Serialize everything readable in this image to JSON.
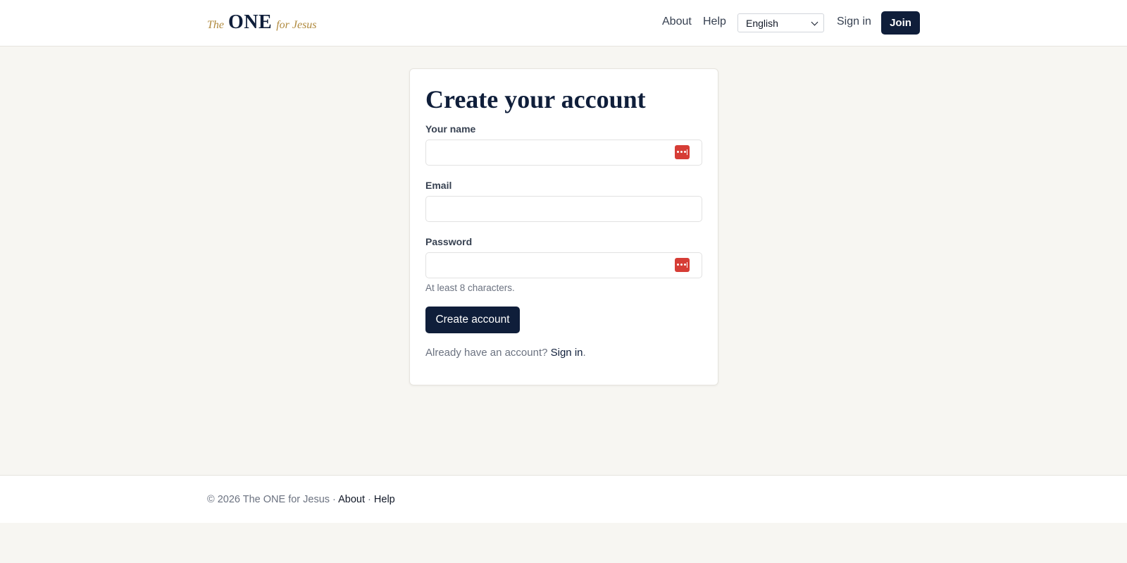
{
  "header": {
    "logo": {
      "the": "The",
      "one": "ONE",
      "rest": "for Jesus"
    },
    "nav": {
      "about": "About",
      "help": "Help",
      "sign_in": "Sign in",
      "join": "Join"
    },
    "language": {
      "selected": "English"
    }
  },
  "form": {
    "title": "Create your account",
    "name": {
      "label": "Your name",
      "value": ""
    },
    "email": {
      "label": "Email",
      "value": ""
    },
    "password": {
      "label": "Password",
      "value": "",
      "hint": "At least 8 characters."
    },
    "submit_label": "Create account",
    "signin_prompt": "Already have an account?",
    "signin_link": "Sign in",
    "signin_suffix": "."
  },
  "footer": {
    "copyright": "© 2026 The ONE for Jesus",
    "sep1": " · ",
    "about": "About",
    "sep2": " · ",
    "help": "Help"
  },
  "colors": {
    "brand_navy": "#0f1e3a",
    "brand_gold": "#b08a3e",
    "page_bg": "#f7f6f2",
    "password_manager_icon": "#d63d36"
  },
  "icons": {
    "name_field_icon": "password-manager-icon",
    "password_field_icon": "password-manager-icon",
    "language_chevron": "chevron-down-icon"
  }
}
